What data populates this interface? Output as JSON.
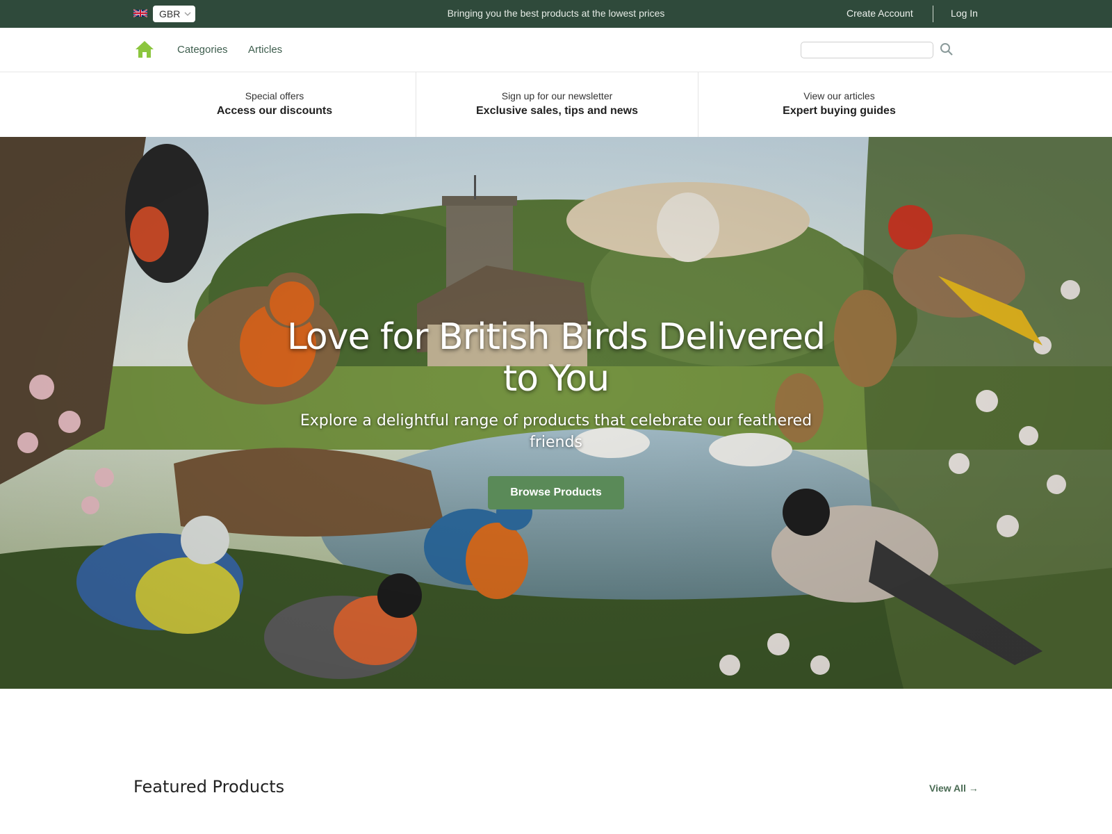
{
  "topbar": {
    "country_code": "GBR",
    "tagline": "Bringing you the best products at the lowest prices",
    "create_account": "Create Account",
    "login": "Log In",
    "flag_icon": "uk-flag-icon"
  },
  "nav": {
    "categories": "Categories",
    "articles": "Articles",
    "search_placeholder": "",
    "home_icon": "home-icon",
    "search_icon": "search-icon"
  },
  "promos": [
    {
      "small": "Special offers",
      "big": "Access our discounts"
    },
    {
      "small": "Sign up for our newsletter",
      "big": "Exclusive sales, tips and news"
    },
    {
      "small": "View our articles",
      "big": "Expert buying guides"
    }
  ],
  "hero": {
    "title_line1": "Love for British Birds Delivered",
    "title_line2": "to You",
    "subtitle_line1": "Explore a delightful range of products that celebrate our feathered",
    "subtitle_line2": "friends",
    "button": "Browse Products"
  },
  "featured": {
    "title": "Featured Products",
    "view_all": "View All →"
  },
  "colors": {
    "topbar_bg": "#2f4a3b",
    "accent_green": "#5a8a58",
    "home_icon": "#8cc63f",
    "link": "#3e5e4e"
  }
}
